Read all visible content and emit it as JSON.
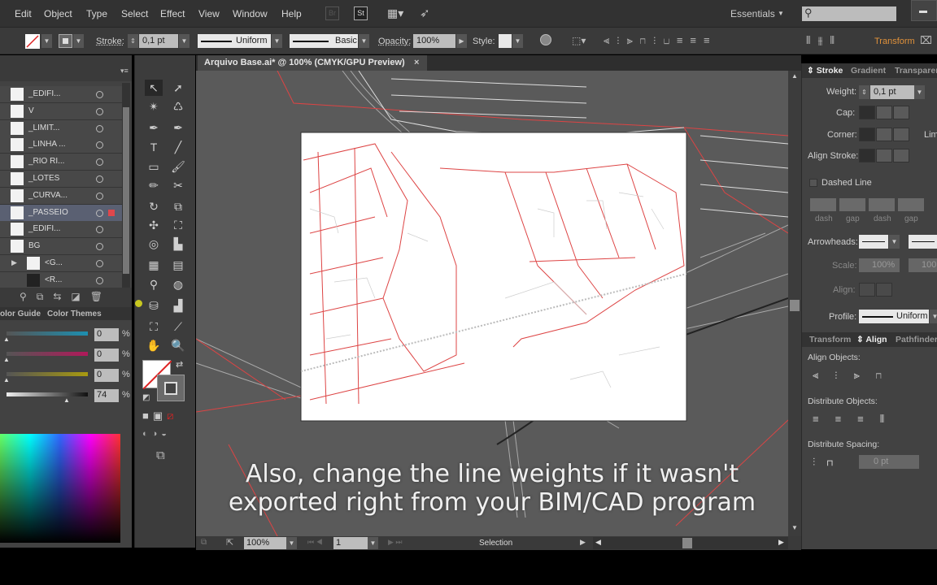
{
  "menu": {
    "items": [
      "Edit",
      "Object",
      "Type",
      "Select",
      "Effect",
      "View",
      "Window",
      "Help"
    ],
    "bridge": "Br",
    "stock": "St",
    "workspace": "Essentials",
    "search_placeholder": ""
  },
  "control": {
    "stroke_label": "Stroke:",
    "stroke_weight": "0,1 pt",
    "profile": "Uniform",
    "brush": "Basic",
    "opacity_label": "Opacity:",
    "opacity": "100%",
    "style_label": "Style:",
    "transform_label": "Transform"
  },
  "document": {
    "tab_title": "Arquivo Base.ai* @ 100% (CMYK/GPU Preview)",
    "close": "×"
  },
  "layers": [
    {
      "name": "_EDIFI...",
      "selected": false
    },
    {
      "name": "V",
      "selected": false
    },
    {
      "name": "_LIMIT...",
      "selected": false
    },
    {
      "name": "_LINHA ...",
      "selected": false
    },
    {
      "name": "_RIO RI...",
      "selected": false
    },
    {
      "name": "_LOTES",
      "selected": false
    },
    {
      "name": "_CURVA...",
      "selected": false
    },
    {
      "name": "_PASSEIO",
      "selected": true
    },
    {
      "name": "_EDIFI...",
      "selected": false
    },
    {
      "name": "BG",
      "selected": false
    },
    {
      "name": "<G...",
      "selected": false
    },
    {
      "name": "<R...",
      "selected": false
    }
  ],
  "color_panel": {
    "tabs": [
      "olor Guide",
      "Color Themes"
    ],
    "cmyk": [
      {
        "value": "0",
        "color": "#1d8fb0"
      },
      {
        "value": "0",
        "color": "#b0195a"
      },
      {
        "value": "0",
        "color": "#a89a10"
      },
      {
        "value": "74",
        "color": "#111111"
      }
    ],
    "pct": "%"
  },
  "stroke_panel": {
    "tabs": [
      "Stroke",
      "Gradient",
      "Transparen"
    ],
    "weight_label": "Weight:",
    "weight": "0,1 pt",
    "cap_label": "Cap:",
    "corner_label": "Corner:",
    "limit_label": "Lim",
    "align_label": "Align Stroke:",
    "dashed_label": "Dashed Line",
    "dash_labels": [
      "dash",
      "gap",
      "dash",
      "gap"
    ],
    "arrowheads_label": "Arrowheads:",
    "scale_label": "Scale:",
    "scale1": "100%",
    "scale2": "100",
    "align2_label": "Align:",
    "profile_label": "Profile:",
    "profile": "Uniform"
  },
  "align_panel": {
    "tabs": [
      "Transform",
      "Align",
      "Pathfinder"
    ],
    "align_objects": "Align Objects:",
    "distribute_objects": "Distribute Objects:",
    "distribute_spacing": "Distribute Spacing:",
    "spacing_value": "0 pt"
  },
  "status": {
    "zoom": "100%",
    "page": "1",
    "tool": "Selection"
  },
  "caption": {
    "line1": "Also, change the line weights if it wasn't",
    "line2": "exported right from your BIM/CAD program"
  },
  "colors": {
    "accent_red": "#e0474c",
    "orange_label": "#e0913a",
    "selected_layer": "#5a6072"
  }
}
